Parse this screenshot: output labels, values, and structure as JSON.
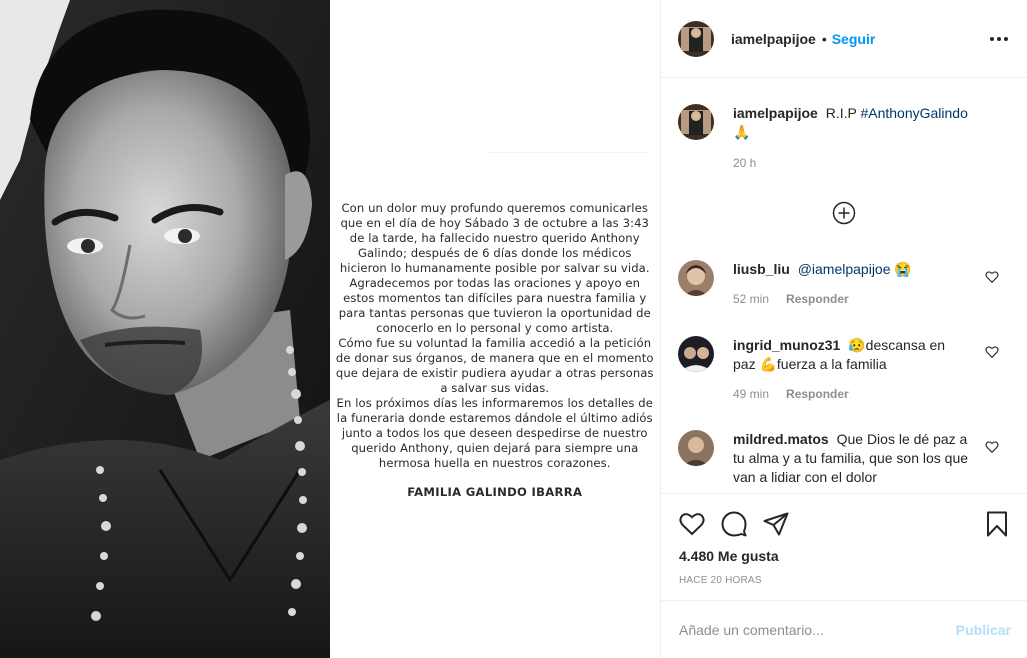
{
  "header": {
    "username": "iamelpapijoe",
    "separator": "•",
    "follow_label": "Seguir",
    "more_icon": "more-horizontal-icon"
  },
  "letter": {
    "paragraphs": [
      "Con un dolor muy profundo queremos comunicarles que en el día de hoy Sábado 3 de octubre a las 3:43 de la tarde, ha fallecido nuestro querido Anthony Galindo; después de 6 días donde los médicos hicieron lo humanamente posible por salvar su vida.",
      "Agradecemos por todas las oraciones y apoyo en estos momentos tan difíciles para nuestra familia y para tantas personas que tuvieron la oportunidad de conocerlo en lo personal y como artista.",
      "Cómo fue su voluntad la familia accedió a la petición de donar sus órganos, de manera que en el momento que dejara de existir pudiera ayudar a otras personas a salvar sus vidas.",
      "En los próximos días les informaremos los detalles de la funeraria donde estaremos dándole el último adiós junto a todos los que deseen despedirse de nuestro querido Anthony, quien dejará para siempre una hermosa huella en nuestros corazones."
    ],
    "signature": "FAMILIA GALINDO IBARRA"
  },
  "caption": {
    "username": "iamelpapijoe",
    "text": "R.I.P",
    "hashtag": "#AnthonyGalindo",
    "emoji": "🙏",
    "time": "20 h"
  },
  "load_more_icon": "plus-circle-icon",
  "comments": [
    {
      "username": "liusb_liu",
      "mention": "@iamelpapijoe",
      "text": "😭",
      "time": "52 min",
      "reply": "Responder"
    },
    {
      "username": "ingrid_munoz31",
      "mention": "",
      "text": "😥descansa en paz 💪fuerza a la familia",
      "time": "49 min",
      "reply": "Responder"
    },
    {
      "username": "mildred.matos",
      "mention": "",
      "text": "Que Dios le dé paz a tu alma y a tu familia, que son los que van a lidiar con el dolor",
      "time": "",
      "reply": ""
    }
  ],
  "actions": {
    "like_icon": "heart-icon",
    "comment_icon": "comment-icon",
    "share_icon": "share-icon",
    "save_icon": "bookmark-icon",
    "likes": "4.480 Me gusta",
    "timestamp": "HACE 20 HORAS"
  },
  "add_comment": {
    "placeholder": "Añade un comentario...",
    "publish": "Publicar"
  },
  "colors": {
    "link": "#0095f6",
    "hashtag": "#00376b",
    "muted": "#8e8e8e",
    "publish_disabled": "#b2dffc"
  }
}
